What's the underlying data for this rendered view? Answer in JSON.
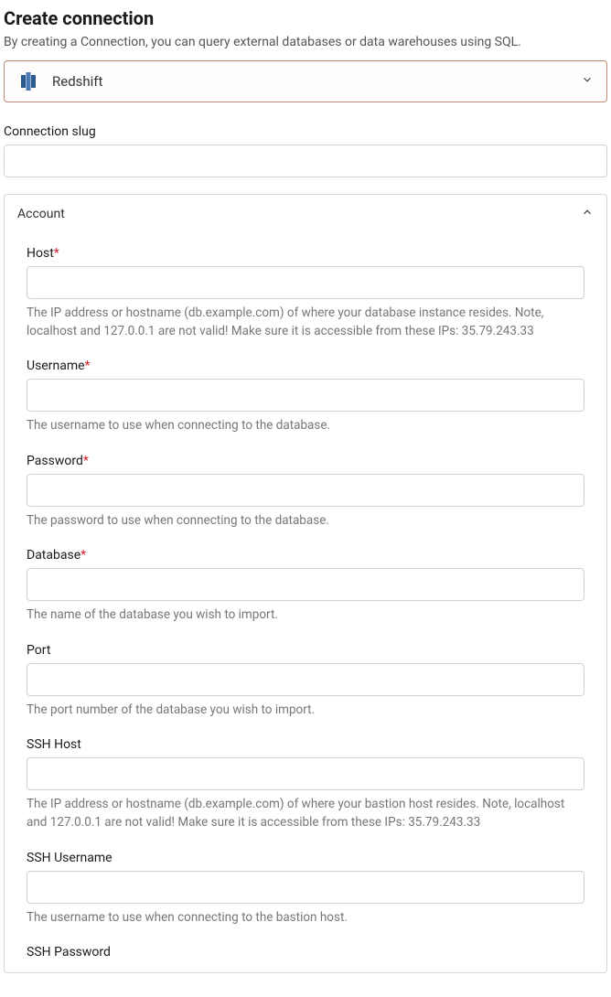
{
  "page": {
    "title": "Create connection",
    "subtitle": "By creating a Connection, you can query external databases or data warehouses using SQL."
  },
  "connector": {
    "selected_label": "Redshift"
  },
  "slug": {
    "label": "Connection slug",
    "value": ""
  },
  "account_section": {
    "title": "Account",
    "fields": {
      "host": {
        "label": "Host",
        "required": true,
        "value": "",
        "help": "The IP address or hostname (db.example.com) of where your database instance resides. Note, localhost and 127.0.0.1 are not valid! Make sure it is accessible from these IPs: 35.79.243.33"
      },
      "username": {
        "label": "Username",
        "required": true,
        "value": "",
        "help": "The username to use when connecting to the database."
      },
      "password": {
        "label": "Password",
        "required": true,
        "value": "",
        "help": "The password to use when connecting to the database."
      },
      "database": {
        "label": "Database",
        "required": true,
        "value": "",
        "help": "The name of the database you wish to import."
      },
      "port": {
        "label": "Port",
        "required": false,
        "value": "",
        "help": "The port number of the database you wish to import."
      },
      "ssh_host": {
        "label": "SSH Host",
        "required": false,
        "value": "",
        "help": "The IP address or hostname (db.example.com) of where your bastion host resides. Note, localhost and 127.0.0.1 are not valid! Make sure it is accessible from these IPs: 35.79.243.33"
      },
      "ssh_username": {
        "label": "SSH Username",
        "required": false,
        "value": "",
        "help": "The username to use when connecting to the bastion host."
      },
      "ssh_password": {
        "label": "SSH Password",
        "required": false,
        "value": "",
        "help": ""
      }
    }
  }
}
